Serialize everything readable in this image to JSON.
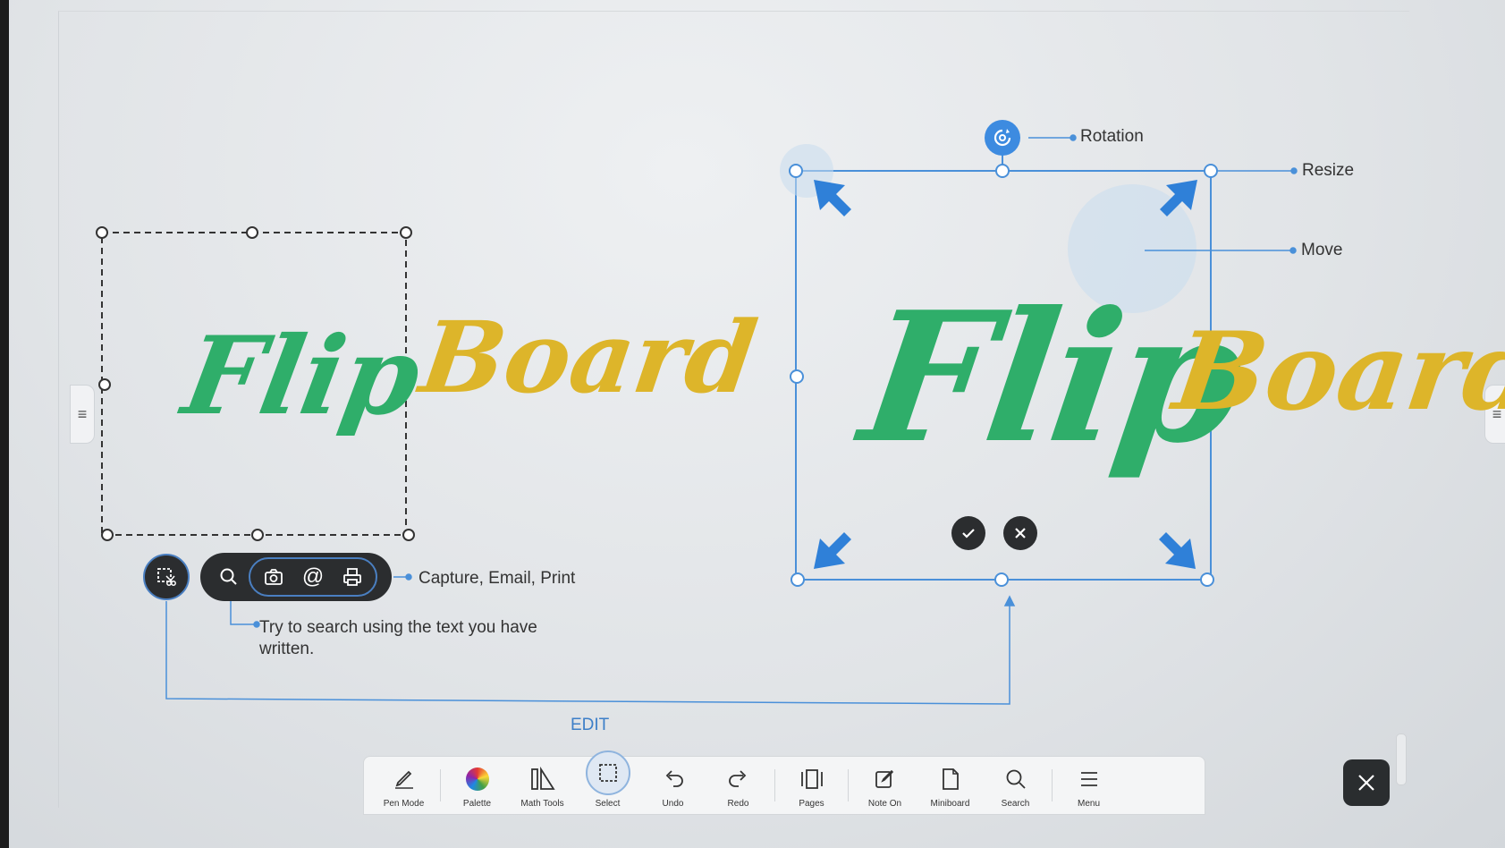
{
  "logos": {
    "left_flip": "Flip",
    "left_board": "Board",
    "right_flip": "Flip",
    "right_board": "Board"
  },
  "annotations": {
    "rotation": "Rotation",
    "resize": "Resize",
    "move": "Move",
    "capture_email_print": "Capture, Email, Print",
    "search_hint": "Try to search using the text you have written.",
    "edit": "EDIT"
  },
  "selection_actions": {
    "confirm_icon": "check-icon",
    "cancel_icon": "close-icon"
  },
  "floating_tools": [
    {
      "name": "edit-selection",
      "icon": "select-scissors-icon"
    },
    {
      "name": "search",
      "icon": "search-icon"
    },
    {
      "name": "capture",
      "icon": "camera-icon"
    },
    {
      "name": "email",
      "icon": "at-icon"
    },
    {
      "name": "print",
      "icon": "printer-icon"
    }
  ],
  "toolbar": {
    "pen_mode": "Pen Mode",
    "palette": "Palette",
    "math_tools": "Math Tools",
    "select": "Select",
    "undo": "Undo",
    "redo": "Redo",
    "pages": "Pages",
    "note_on": "Note On",
    "miniboard": "Miniboard",
    "search": "Search",
    "menu": "Menu"
  },
  "colors": {
    "accent_blue": "#3d7fc8",
    "flip_green": "#2fae6a",
    "board_yellow": "#ddb52a",
    "dark_button": "#2b2d2f"
  }
}
